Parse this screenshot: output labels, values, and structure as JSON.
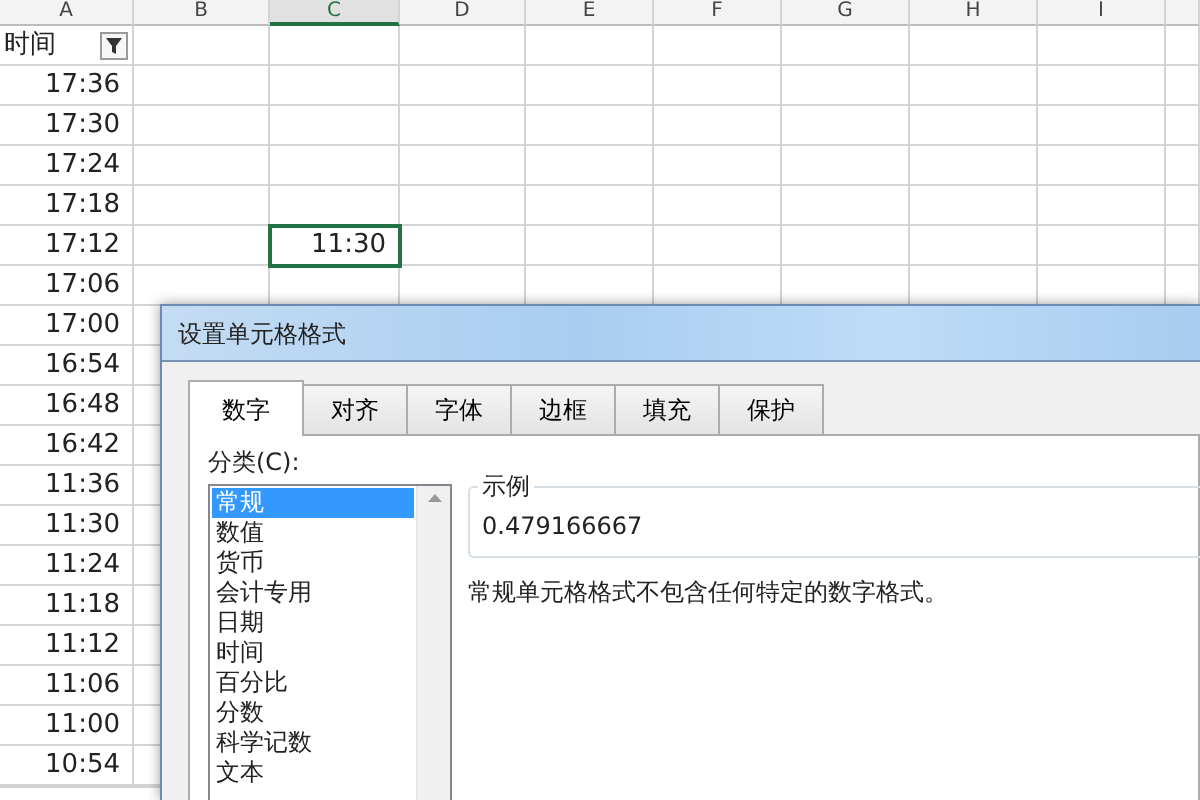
{
  "sheet": {
    "columns": [
      {
        "label": "A",
        "selected": false
      },
      {
        "label": "B",
        "selected": false
      },
      {
        "label": "C",
        "selected": true
      },
      {
        "label": "D",
        "selected": false
      },
      {
        "label": "E",
        "selected": false
      },
      {
        "label": "F",
        "selected": false
      },
      {
        "label": "G",
        "selected": false
      },
      {
        "label": "H",
        "selected": false
      },
      {
        "label": "I",
        "selected": false
      }
    ],
    "header_cell": {
      "text": "时间",
      "filter": true
    },
    "rows": [
      {
        "column_a": "17:36"
      },
      {
        "column_a": "17:30"
      },
      {
        "column_a": "17:24"
      },
      {
        "column_a": "17:18"
      },
      {
        "column_a": "17:12",
        "column_c": {
          "text": "11:30",
          "selected": true
        }
      },
      {
        "column_a": "17:06"
      },
      {
        "column_a": "17:00"
      },
      {
        "column_a": "16:54"
      },
      {
        "column_a": "16:48"
      },
      {
        "column_a": "16:42"
      },
      {
        "column_a": "11:36"
      },
      {
        "column_a": "11:30"
      },
      {
        "column_a": "11:24"
      },
      {
        "column_a": "11:18"
      },
      {
        "column_a": "11:12"
      },
      {
        "column_a": "11:06"
      },
      {
        "column_a": "11:00"
      },
      {
        "column_a": "10:54"
      }
    ]
  },
  "dialog": {
    "title": "设置单元格格式",
    "tabs": [
      {
        "label": "数字",
        "selected": true
      },
      {
        "label": "对齐",
        "selected": false
      },
      {
        "label": "字体",
        "selected": false
      },
      {
        "label": "边框",
        "selected": false
      },
      {
        "label": "填充",
        "selected": false
      },
      {
        "label": "保护",
        "selected": false
      }
    ],
    "category_label": "分类(C):",
    "categories": [
      {
        "label": "常规",
        "selected": true
      },
      {
        "label": "数值",
        "selected": false
      },
      {
        "label": "货币",
        "selected": false
      },
      {
        "label": "会计专用",
        "selected": false
      },
      {
        "label": "日期",
        "selected": false
      },
      {
        "label": "时间",
        "selected": false
      },
      {
        "label": "百分比",
        "selected": false
      },
      {
        "label": "分数",
        "selected": false
      },
      {
        "label": "科学记数",
        "selected": false
      },
      {
        "label": "文本",
        "selected": false
      }
    ],
    "sample": {
      "legend": "示例",
      "value": "0.479166667"
    },
    "description": "常规单元格格式不包含任何特定的数字格式。"
  }
}
